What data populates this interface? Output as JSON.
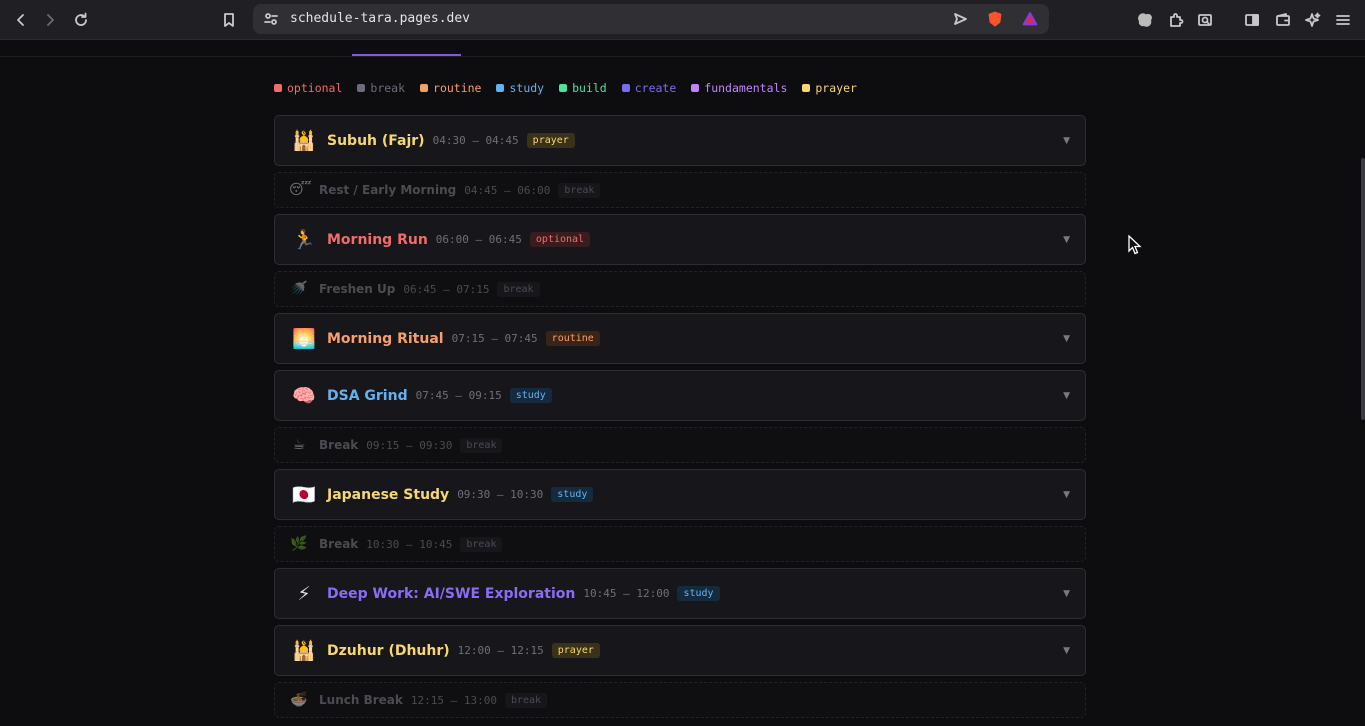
{
  "browser": {
    "url": "schedule-tara.pages.dev"
  },
  "legend": [
    {
      "label": "optional",
      "color": "#f26b6b"
    },
    {
      "label": "break",
      "color": "#6b6b7b"
    },
    {
      "label": "routine",
      "color": "#f59f6b"
    },
    {
      "label": "study",
      "color": "#62b2f2"
    },
    {
      "label": "build",
      "color": "#4ee29c"
    },
    {
      "label": "create",
      "color": "#7a6cf0"
    },
    {
      "label": "fundamentals",
      "color": "#c084fc"
    },
    {
      "label": "prayer",
      "color": "#f7d774"
    }
  ],
  "items": [
    {
      "kind": "block",
      "emoji": "🕌",
      "title": "Subuh (Fajr)",
      "time": "04:30 – 04:45",
      "tag": "prayer",
      "color": "#f7d774",
      "tagBg": "#3a3218"
    },
    {
      "kind": "break",
      "emoji": "😴",
      "title": "Rest / Early Morning",
      "time": "04:45 – 06:00",
      "tag": "break"
    },
    {
      "kind": "block",
      "emoji": "🏃",
      "title": "Morning Run",
      "time": "06:00 – 06:45",
      "tag": "optional",
      "color": "#f26b6b",
      "tagBg": "#3a1c1e"
    },
    {
      "kind": "break",
      "emoji": "🚿",
      "title": "Freshen Up",
      "time": "06:45 – 07:15",
      "tag": "break"
    },
    {
      "kind": "block",
      "emoji": "🌅",
      "title": "Morning Ritual",
      "time": "07:15 – 07:45",
      "tag": "routine",
      "color": "#f59f6b",
      "tagBg": "#3a2418"
    },
    {
      "kind": "block",
      "emoji": "🧠",
      "title": "DSA Grind",
      "time": "07:45 – 09:15",
      "tag": "study",
      "color": "#62b2f2",
      "tagBg": "#152a3c"
    },
    {
      "kind": "break",
      "emoji": "☕",
      "title": "Break",
      "time": "09:15 – 09:30",
      "tag": "break"
    },
    {
      "kind": "block",
      "emoji": "🇯🇵",
      "title": "Japanese Study",
      "time": "09:30 – 10:30",
      "tag": "study",
      "color": "#f7d774",
      "tagBg": "#152a3c",
      "tagColor": "#62b2f2"
    },
    {
      "kind": "break",
      "emoji": "🌿",
      "title": "Break",
      "time": "10:30 – 10:45",
      "tag": "break"
    },
    {
      "kind": "block",
      "emoji": "⚡",
      "title": "Deep Work: AI/SWE Exploration",
      "time": "10:45 – 12:00",
      "tag": "study",
      "color": "#8b6cf6",
      "tagBg": "#152a3c",
      "tagColor": "#62b2f2"
    },
    {
      "kind": "block",
      "emoji": "🕌",
      "title": "Dzuhur (Dhuhr)",
      "time": "12:00 – 12:15",
      "tag": "prayer",
      "color": "#f7d774",
      "tagBg": "#3a3218"
    },
    {
      "kind": "break",
      "emoji": "🍜",
      "title": "Lunch Break",
      "time": "12:15 – 13:00",
      "tag": "break"
    }
  ]
}
